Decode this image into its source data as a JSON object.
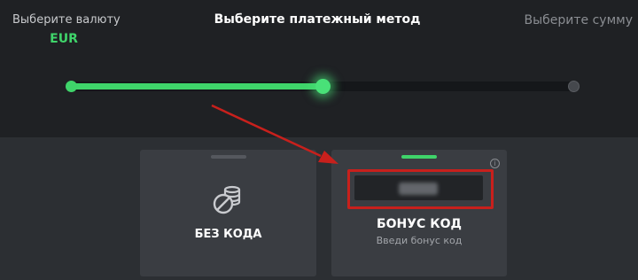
{
  "steps": {
    "currency": {
      "label": "Выберите валюту",
      "value": "EUR"
    },
    "method": {
      "label": "Выберите платежный метод"
    },
    "amount": {
      "label": "Выберите сумму"
    }
  },
  "progress": {
    "current_step": 2,
    "total_steps": 3,
    "fraction": 0.5
  },
  "cards": {
    "nocode": {
      "title": "БЕЗ КОДА",
      "icon": "no-coins-icon"
    },
    "bonus": {
      "title": "БОНУС КОД",
      "subtitle": "Введи бонус код",
      "info_glyph": "i",
      "icon": "info-icon"
    }
  },
  "colors": {
    "accent": "#3fd46a",
    "highlight": "#c8201c",
    "background": "#1f2124",
    "card": "#3a3d42"
  }
}
